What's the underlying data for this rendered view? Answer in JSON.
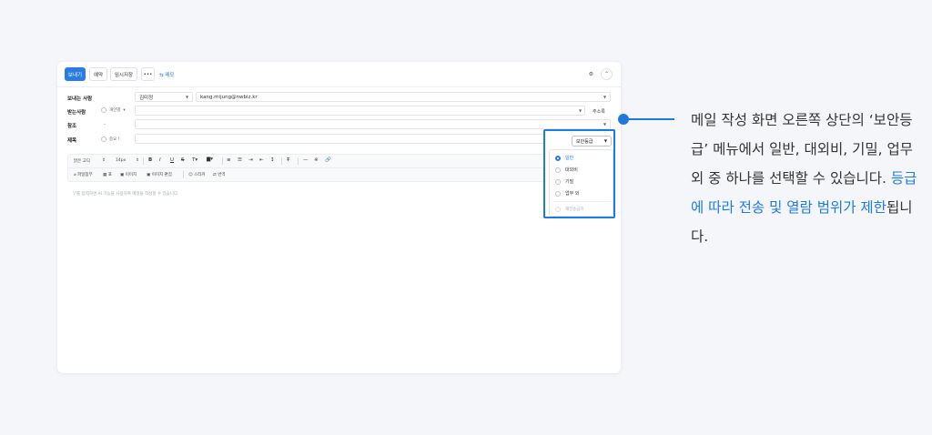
{
  "toolbar": {
    "send": "보내기",
    "reserve": "예약",
    "draft": "임시저장",
    "more": "•••",
    "memo": "⇆ 메모",
    "settings_icon": "gear-icon",
    "collapse_icon": "chevron-up-icon"
  },
  "form": {
    "sender_label": "보내는 사람",
    "sender_name": "김미정",
    "sender_email": "kang.mijung@nwbiz.kr",
    "to_label": "받는사람",
    "individual": "개인별",
    "address_book": "주소록",
    "cc_label": "참조",
    "cc_dash": "-",
    "subject_label": "제목",
    "important": "중요 !"
  },
  "editor": {
    "font": "맑은 고딕",
    "size": "14px",
    "bold": "B",
    "italic": "I",
    "underline": "U",
    "strike": "S",
    "attach": "파일첨부",
    "table": "표",
    "image": "이미지",
    "image_edit": "이미지 편집",
    "sticker": "스티커",
    "translate": "번역",
    "placeholder": "'/'를 입력하면 AI 기능을 사용하여 메일을 작성할 수 있습니다."
  },
  "security": {
    "button": "보안등급",
    "options": [
      "일반",
      "대외비",
      "기밀",
      "업무 외"
    ],
    "selected": "일반",
    "forward_ban": "재전송금지"
  },
  "description": {
    "part1": "메일 작성 화면 오른쪽 상단의 ‘보안등급’ 메뉴에서 일반, 대외비, 기밀, 업무 외 중 하나를 선택할 수 있습니다. ",
    "highlight": "등급에 따라 전송 및 열람 범위가 제한",
    "part2": "됩니다."
  }
}
